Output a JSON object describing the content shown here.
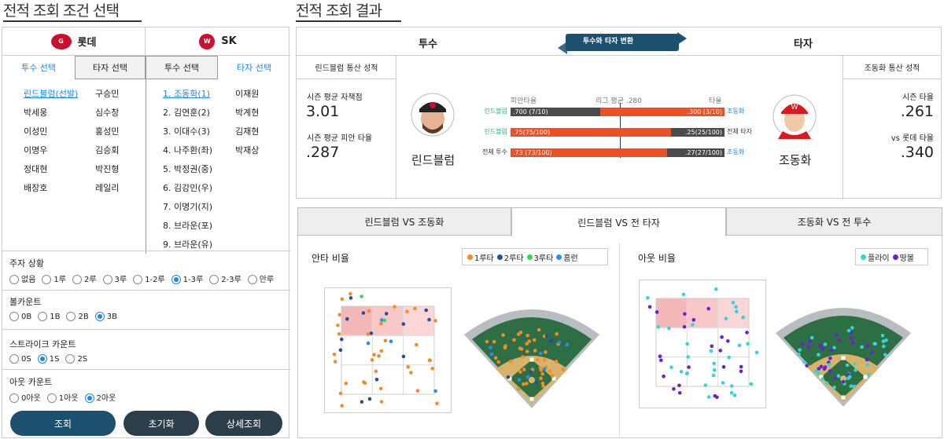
{
  "left": {
    "title": "전적 조회 조건 선택",
    "team1": {
      "name": "롯데"
    },
    "team2": {
      "name": "SK"
    },
    "tabs": {
      "pitcher": "투수 선택",
      "batter": "타자 선택"
    },
    "col1": [
      "린드블럼(선발)",
      "박세웅",
      "이성민",
      "이명우",
      "정대현",
      "배장호"
    ],
    "col2": [
      "구승민",
      "심수창",
      "홍성민",
      "김승회",
      "박진형",
      "레일리"
    ],
    "col3": [
      "1. 조동화(1)",
      "2. 김연훈(2)",
      "3. 이대수(3)",
      "4. 나주환(좌)",
      "5. 박정권(중)",
      "6. 김강민(우)",
      "7. 이명기(지)",
      "8. 브라운(포)",
      "9. 브라운(유)"
    ],
    "col4": [
      "이재원",
      "박계현",
      "김재현",
      "박재상"
    ],
    "runner": {
      "label": "주자 상황",
      "options": [
        "없음",
        "1루",
        "2루",
        "3루",
        "1-2루",
        "1-3루",
        "2-3루",
        "만루"
      ],
      "selected": "1-3루"
    },
    "ball": {
      "label": "볼카운트",
      "options": [
        "0B",
        "1B",
        "2B",
        "3B"
      ],
      "selected": "3B"
    },
    "strike": {
      "label": "스트라이크 카운트",
      "options": [
        "0S",
        "1S",
        "2S"
      ],
      "selected": "1S"
    },
    "out": {
      "label": "아웃 카운트",
      "options": [
        "0아웃",
        "1아웃",
        "2아웃"
      ],
      "selected": "2아웃"
    },
    "buttons": {
      "search": "조회",
      "reset": "초기화",
      "detail": "상세조회"
    }
  },
  "right": {
    "title": "전적 조회 결과",
    "pitcher_label": "투수",
    "batter_label": "타자",
    "switch_label": "투수와 타자 변환",
    "pitcher_stats_title": "린드블럼 통산 성적",
    "batter_stats_title": "조동화 통산 성적",
    "era_label": "시즌 평균 자책점",
    "era": "3.01",
    "opp_label": "시즌 평균 피안 타율",
    "opp": ".287",
    "avg_label": "시즌 타율",
    "avg": ".261",
    "vs_label": "vs 롯데 타율",
    "vs": ".340",
    "pitcher_name": "린드블럼",
    "batter_name": "조동화",
    "bar_hdr_left": "피안타율",
    "bar_hdr_mid": "리그 평균 .280",
    "bar_hdr_right": "타율",
    "league_avg": 0.28,
    "rows": [
      {
        "left_label": "린드블럼",
        "left_text": ".700 (7/10)",
        "left_val": 0.7,
        "right_text": ".300 (3/10)",
        "right_val": 0.3,
        "right_label": "조동화"
      },
      {
        "left_label": "린드블럼",
        "left_text": ".75(75/100)",
        "left_val": 0.75,
        "right_text": ".25(25/100)",
        "right_val": 0.25,
        "right_label": "전체 타자"
      },
      {
        "left_label": "전체 투수",
        "left_text": ".73 (73/100)",
        "left_val": 0.73,
        "right_text": ".27(27/100)",
        "right_val": 0.27,
        "right_label": "조동화"
      }
    ],
    "tabs": [
      "린드블럼 VS 조동화",
      "린드블럼 VS 전 타자",
      "조동화 VS 전 투수"
    ],
    "hit_title": "안타 비율",
    "hit_legend": [
      "1루타",
      "2루타",
      "3루타",
      "홈런"
    ],
    "out_title": "아웃 비율",
    "out_legend": [
      "플라이",
      "땅볼"
    ],
    "colors": {
      "single": "#f28c28",
      "double": "#2a4d9b",
      "triple": "#3ad35a",
      "homer": "#2a8ee8",
      "fly": "#33d6d6",
      "ground": "#6a1fd1",
      "bar_orange": "#ef5023",
      "bar_gray": "#4b4b4b"
    }
  }
}
